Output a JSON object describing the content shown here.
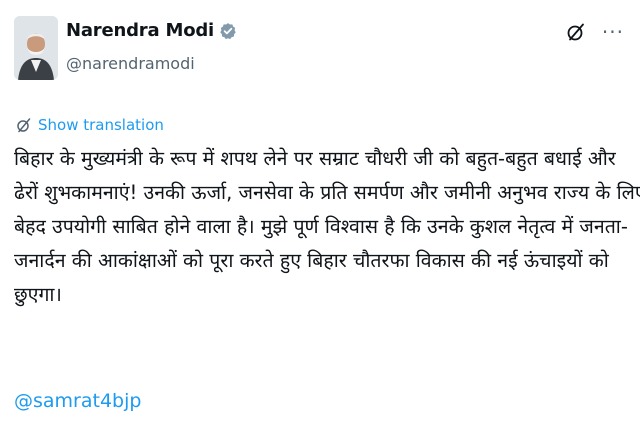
{
  "author": {
    "display_name": "Narendra Modi",
    "handle": "@narendramodi",
    "verified": true
  },
  "header_icons": [
    "grok-icon",
    "more-options-icon"
  ],
  "more_label": "···",
  "translation": {
    "label": "Show translation",
    "icon": "translate-icon"
  },
  "tweet": {
    "lines": [
      "बिहार के मुख्यमंत्री के रूप में शपथ लेने पर सम्राट चौधरी जी को बहुत-बहुत बधाई और",
      "ढेरों शुभकामनाएं! उनकी ऊर्जा, जनसेवा के प्रति समर्पण और जमीनी अनुभव राज्य के लिए",
      "बेहद उपयोगी साबित होने वाला है। मुझे पूर्ण विश्वास है कि उनके कुशल नेतृत्व में जनता-",
      "जनार्दन की आकांक्षाओं को पूरा करते हुए बिहार चौतरफा विकास की नई ऊंचाइयों को",
      "छुएगा।"
    ],
    "mention": "@samrat4bjp"
  },
  "colors": {
    "link": "#1d9bf0",
    "verified_badge": "#829aab",
    "secondary_text": "#536471"
  }
}
